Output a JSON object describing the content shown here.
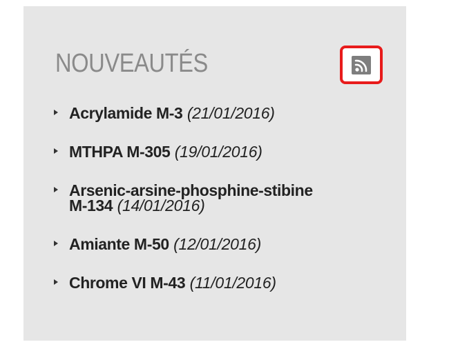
{
  "section": {
    "title": "NOUVEAUTÉS"
  },
  "items": [
    {
      "name": "Acrylamide M-3",
      "date": "(21/01/2016)"
    },
    {
      "name": "MTHPA M-305",
      "date": "(19/01/2016)"
    },
    {
      "name_line1": "Arsenic-arsine-phosphine-stibine",
      "name_line2": "M-134",
      "date": "(14/01/2016)"
    },
    {
      "name": "Amiante M-50",
      "date": "(12/01/2016)"
    },
    {
      "name": "Chrome VI M-43",
      "date": "(11/01/2016)"
    }
  ],
  "icons": {
    "rss": "rss-feed-icon",
    "bullet": "triangle-right-icon"
  },
  "colors": {
    "panel_background": "#e6e6e6",
    "heading": "#8a8a8a",
    "highlight_border": "#e81b1b",
    "rss_icon": "#7e7e7e",
    "text": "#222222"
  }
}
